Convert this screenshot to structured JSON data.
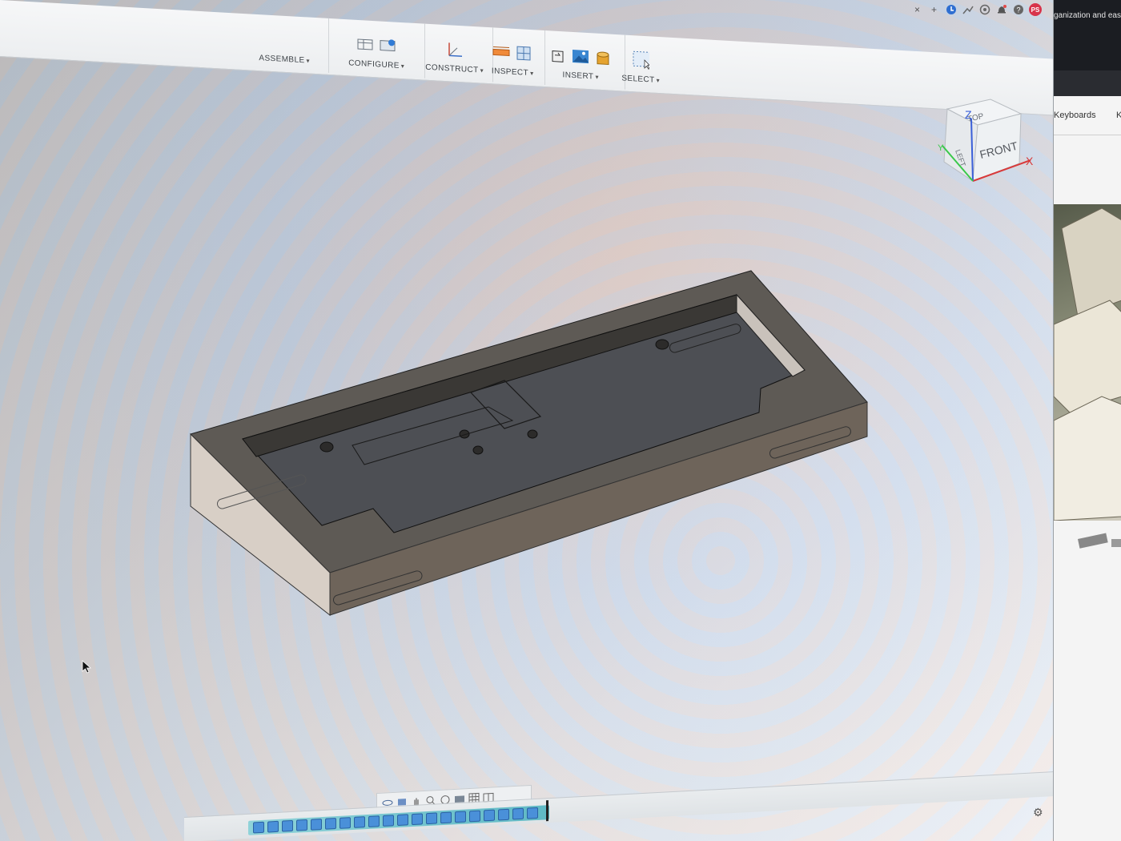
{
  "toolbar": {
    "groups": [
      {
        "label": "ASSEMBLE"
      },
      {
        "label": "CONFIGURE"
      },
      {
        "label": "CONSTRUCT"
      },
      {
        "label": "INSPECT"
      },
      {
        "label": "INSERT"
      },
      {
        "label": "SELECT"
      }
    ]
  },
  "window_controls": {
    "close_symbol": "×",
    "plus_symbol": "+",
    "avatar_initials": "PS"
  },
  "viewcube": {
    "top": "TOP",
    "front": "FRONT",
    "left": "LEFT",
    "axis_x": "X",
    "axis_y": "Y",
    "axis_z": "Z"
  },
  "browser": {
    "banner_text": "ganization and easy",
    "tab_keyboards": "Keyboards",
    "tab_next": "K"
  },
  "colors": {
    "toolbar_bg": "#f0f2f4",
    "model_fill": "#6a6660",
    "accent_red": "#d8344b",
    "timeline_teal": "#5fb9c5"
  }
}
